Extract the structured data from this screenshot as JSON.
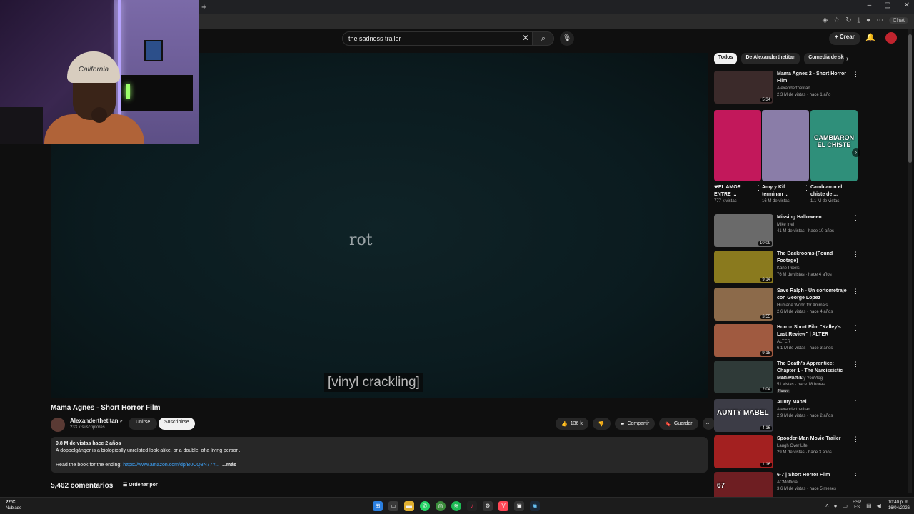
{
  "browser": {
    "new_tab_glyph": "+",
    "window_controls": [
      "–",
      "▢",
      "✕"
    ],
    "chat_label": "Chat"
  },
  "search": {
    "query": "the sadness trailer",
    "clear_glyph": "✕",
    "search_glyph": "⌕",
    "mic_glyph": "🎙"
  },
  "header": {
    "create_label": "Crear",
    "create_glyph": "+",
    "bell_glyph": "🔔"
  },
  "webcam": {
    "cap_text": "California"
  },
  "player": {
    "word": "rot",
    "caption": "[vinyl crackling]"
  },
  "video": {
    "title": "Mama Agnes - Short Horror Film",
    "channel": "Alexanderthetitan",
    "verified_glyph": "✔",
    "subscribers": "233 k suscriptores",
    "join_label": "Unirse",
    "subscribe_label": "Suscribirse",
    "likes": "136 k",
    "share_label": "Compartir",
    "save_label": "Guardar",
    "more_glyph": "⋯"
  },
  "description": {
    "meta": "9.8 M de vistas  hace 2 años",
    "line1": "A doppelgänger is a biologically unrelated look-alike, or a double, of a living person.",
    "read_prefix": "Read the book for the ending: ",
    "link": "https://www.amazon.com/dp/B0CQ8N77Y...",
    "more": "...más"
  },
  "comments": {
    "count": "5,462 comentarios",
    "sort_label": "Ordenar por"
  },
  "chips": [
    "Todos",
    "De Alexanderthetitan",
    "Comedia de sketches"
  ],
  "recs_top": [
    {
      "title": "Mama Agnes 2 - Short Horror Film",
      "channel": "Alexanderthetitan",
      "meta": "2.3 M de vistas · hace 1 año",
      "duration": "5:34",
      "thumb_color": "#3b2a2a"
    }
  ],
  "shorts": [
    {
      "title": "❤EL AMOR ENTRE ...",
      "views": "777 k vistas",
      "thumb_color": "#c2185b"
    },
    {
      "title": "Amy y Kif terminan ...",
      "views": "16 M de vistas",
      "thumb_color": "#8a7da8"
    },
    {
      "title": "Cambiaron el chiste de ...",
      "views": "1.1 M de vistas",
      "thumb_color": "#2f8f7a",
      "overlay": "CAMBIARON EL CHISTE"
    }
  ],
  "recs": [
    {
      "title": "Missing Halloween",
      "channel": "Mike Inel",
      "meta": "41 M de vistas · hace 10 años",
      "duration": "10:09",
      "thumb_color": "#6a6a6a"
    },
    {
      "title": "The Backrooms (Found Footage)",
      "channel": "Kane Pixels",
      "meta": "76 M de vistas · hace 4 años",
      "duration": "9:14",
      "thumb_color": "#8a7a1e"
    },
    {
      "title": "Save Ralph - Un cortometraje con George Lopez",
      "channel": "Humane World for Animals",
      "meta": "2.6 M de vistas · hace 4 años",
      "duration": "3:55",
      "thumb_color": "#8c6a4a"
    },
    {
      "title": "Horror Short Film \"Kalley's Last Review\" | ALTER",
      "channel": "ALTER",
      "meta": "6.1 M de vistas · hace 3 años",
      "duration": "9:18",
      "thumb_color": "#a05a40"
    },
    {
      "title": "The Death's Apprentice: Chapter 1 - The Narcissistic Man Part 1",
      "channel": "Theowlmonkey YouVlog",
      "meta": "51 vistas · hace 18 horas",
      "duration": "2:04",
      "badge": "Nuevo",
      "thumb_color": "#2f3a38"
    },
    {
      "title": "Aunty Mabel",
      "channel": "Alexanderthetitan",
      "meta": "2.9 M de vistas · hace 2 años",
      "duration": "4:16",
      "thumb_color": "#3c3c46",
      "overlay": "AUNTY MABEL"
    },
    {
      "title": "Spooder-Man Movie Trailer",
      "channel": "Laugh Over Life",
      "meta": "29 M de vistas · hace 3 años",
      "duration": "1:16",
      "thumb_color": "#a32020"
    },
    {
      "title": "6-7 | Short Horror Film",
      "channel": "ACMofficial",
      "meta": "3.6 M de vistas · hace 5 meses",
      "duration": "",
      "thumb_color": "#6e1e22",
      "overlay": "67"
    }
  ],
  "taskbar": {
    "temp": "22°C",
    "weather": "Nublado",
    "lang1": "ESP",
    "lang2": "ES",
    "time": "10:40 p. m.",
    "date": "16/04/2026"
  }
}
